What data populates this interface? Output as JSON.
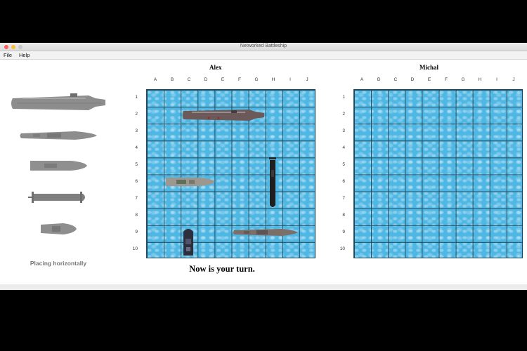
{
  "window": {
    "title": "Networked Battleship"
  },
  "menu": [
    {
      "label": "File"
    },
    {
      "label": "Help"
    }
  ],
  "palette": {
    "ships": [
      {
        "name": "carrier",
        "icon": "carrier-icon"
      },
      {
        "name": "battleship",
        "icon": "battleship-icon"
      },
      {
        "name": "cruiser",
        "icon": "cruiser-icon"
      },
      {
        "name": "submarine",
        "icon": "submarine-icon"
      },
      {
        "name": "destroyer",
        "icon": "destroyer-icon"
      }
    ],
    "orientation_label": "Placing horizontally"
  },
  "columns": [
    "A",
    "B",
    "C",
    "D",
    "E",
    "F",
    "G",
    "H",
    "I",
    "J"
  ],
  "rows": [
    "1",
    "2",
    "3",
    "4",
    "5",
    "6",
    "7",
    "8",
    "9",
    "10"
  ],
  "boards": {
    "own": {
      "player": "Alex",
      "ships": [
        {
          "type": "carrier",
          "start": "C2",
          "end": "G2",
          "orientation": "horizontal"
        },
        {
          "type": "battleship",
          "start": "F9",
          "end": "I9",
          "orientation": "horizontal"
        },
        {
          "type": "cruiser",
          "start": "B6",
          "end": "D6",
          "orientation": "horizontal"
        },
        {
          "type": "submarine",
          "start": "H5",
          "end": "H7",
          "orientation": "vertical"
        },
        {
          "type": "destroyer",
          "start": "C9",
          "end": "C10",
          "orientation": "vertical"
        }
      ]
    },
    "opponent": {
      "player": "Michal"
    }
  },
  "status": {
    "message": "Now is your turn."
  },
  "colors": {
    "water": "#4fb7e3",
    "grid_line": "#1f4a5e",
    "ship_gray": "#8a8a8a"
  }
}
